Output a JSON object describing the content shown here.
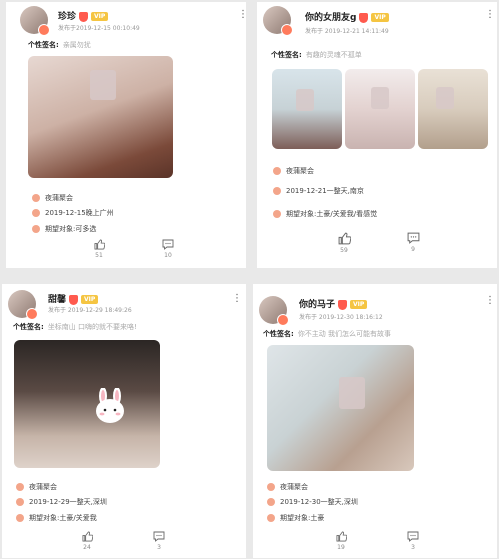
{
  "common": {
    "sig_label": "个性签名:",
    "event": "夜蒲聚会"
  },
  "posts": [
    {
      "name": "珍珍",
      "time": "发布于2019-12-15 00:10:49",
      "signature": "亲属勿扰",
      "date_place": "2019-12-15晚上广州",
      "expect": "期望对象:可多选",
      "likes": "51",
      "comments": "10",
      "vip": "VIP"
    },
    {
      "name": "你的女朋友g",
      "time": "发布于 2019-12-21 14:11:49",
      "signature": "有趣的灵魂不孤单",
      "date_place": "2019-12-21一整天,南京",
      "expect": "期望对象:土豪/关爱我/看感觉",
      "likes": "59",
      "comments": "9",
      "vip": "VIP"
    },
    {
      "name": "甜馨",
      "time": "发布于 2019-12-29 18:49:26",
      "signature": "坐标南山 口嗨的就不要来咯!",
      "date_place": "2019-12-29一整天,深圳",
      "expect": "期望对象:土豪/关爱我",
      "likes": "24",
      "comments": "3",
      "vip": "VIP"
    },
    {
      "name": "你的马子",
      "time": "发布于 2019-12-30 18:16:12",
      "signature": "你不主动 我们怎么可能有故事",
      "date_place": "2019-12-30一整天,深圳",
      "expect": "期望对象:土豪",
      "likes": "19",
      "comments": "3",
      "vip": "VIP"
    }
  ],
  "colors": {
    "accent": "#ff5a4e",
    "vip": "#f5c542",
    "bg": "#e9e9e9"
  }
}
